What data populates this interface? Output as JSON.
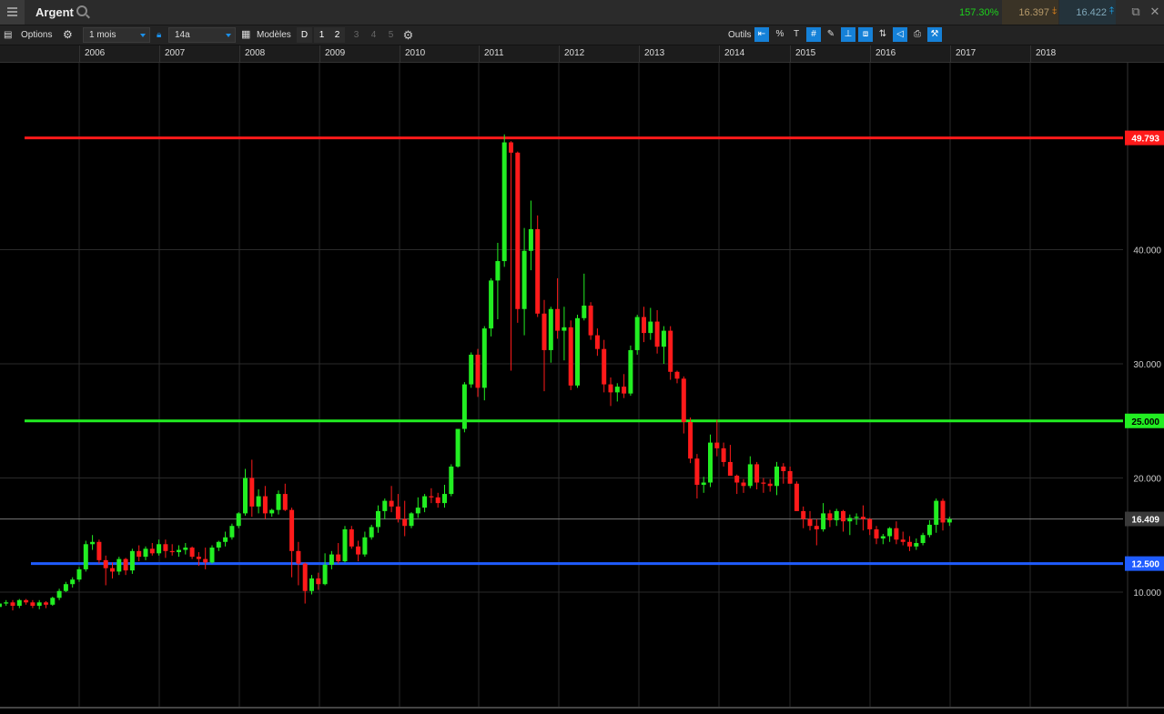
{
  "header": {
    "title": "Argent",
    "change_pct": "157.30%",
    "sell_price": "16.397",
    "buy_price": "16.422"
  },
  "toolbar": {
    "options_label": "Options",
    "interval_value": "1 mois",
    "range_value": "14a",
    "models_label": "Modèles",
    "period_buttons": [
      "D",
      "1",
      "2",
      "3",
      "4",
      "5"
    ],
    "tools_label": "Outils"
  },
  "chart_data": {
    "type": "candlestick",
    "title": "",
    "x_tick_labels": [
      "2006",
      "2007",
      "2008",
      "2009",
      "2010",
      "2011",
      "2012",
      "2013",
      "2014",
      "2015",
      "2016",
      "2017",
      "2018"
    ],
    "y_tick_labels": [
      "10.000",
      "20.000",
      "30.000",
      "40.000"
    ],
    "ylim": [
      2.5,
      52.5
    ],
    "grid": true,
    "current_price": "16.409",
    "horizontal_lines": [
      {
        "value": 49.793,
        "label": "49.793",
        "color": "#ff1a1a"
      },
      {
        "value": 25.0,
        "label": "25.000",
        "color": "#22ee22"
      },
      {
        "value": 12.5,
        "label": "12.500",
        "color": "#1f5cff"
      }
    ],
    "candles": [
      [
        8.7,
        9.3,
        8.3,
        9.0
      ],
      [
        9.0,
        9.3,
        8.8,
        9.1
      ],
      [
        9.1,
        9.3,
        8.4,
        8.8
      ],
      [
        8.8,
        9.4,
        8.6,
        9.3
      ],
      [
        9.3,
        9.4,
        8.9,
        9.1
      ],
      [
        9.1,
        9.3,
        8.6,
        8.8
      ],
      [
        8.8,
        9.3,
        8.5,
        9.1
      ],
      [
        9.1,
        9.2,
        8.6,
        8.9
      ],
      [
        8.9,
        9.6,
        8.8,
        9.5
      ],
      [
        9.5,
        10.3,
        9.3,
        10.1
      ],
      [
        10.1,
        10.9,
        10.0,
        10.7
      ],
      [
        10.7,
        11.3,
        10.4,
        11.1
      ],
      [
        11.1,
        12.2,
        10.9,
        12.0
      ],
      [
        12.0,
        14.5,
        11.8,
        14.2
      ],
      [
        14.2,
        15.0,
        13.7,
        14.4
      ],
      [
        14.4,
        14.6,
        12.5,
        12.8
      ],
      [
        12.8,
        13.2,
        10.6,
        12.1
      ],
      [
        12.1,
        12.6,
        11.2,
        11.8
      ],
      [
        11.8,
        13.1,
        11.5,
        12.9
      ],
      [
        12.9,
        13.0,
        11.5,
        11.9
      ],
      [
        11.9,
        13.8,
        11.6,
        13.6
      ],
      [
        13.6,
        14.1,
        12.7,
        13.1
      ],
      [
        13.1,
        14.0,
        12.8,
        13.8
      ],
      [
        13.8,
        14.3,
        13.2,
        13.4
      ],
      [
        13.4,
        14.6,
        13.2,
        14.2
      ],
      [
        14.2,
        14.6,
        13.0,
        13.6
      ],
      [
        13.6,
        14.2,
        13.2,
        13.5
      ],
      [
        13.5,
        14.1,
        13.1,
        13.7
      ],
      [
        13.7,
        14.3,
        13.3,
        13.9
      ],
      [
        13.9,
        14.0,
        12.9,
        13.1
      ],
      [
        13.1,
        13.5,
        12.3,
        12.9
      ],
      [
        12.9,
        13.9,
        12.0,
        12.6
      ],
      [
        12.6,
        14.1,
        12.5,
        13.9
      ],
      [
        13.9,
        14.5,
        13.6,
        14.4
      ],
      [
        14.4,
        15.3,
        14.0,
        14.8
      ],
      [
        14.8,
        16.0,
        14.6,
        15.8
      ],
      [
        15.8,
        17.0,
        15.6,
        16.9
      ],
      [
        16.9,
        20.8,
        16.7,
        20.0
      ],
      [
        20.0,
        21.6,
        16.6,
        17.5
      ],
      [
        17.5,
        19.0,
        16.9,
        18.4
      ],
      [
        18.4,
        19.3,
        16.4,
        16.9
      ],
      [
        16.9,
        17.3,
        16.6,
        17.2
      ],
      [
        17.2,
        18.9,
        16.8,
        18.6
      ],
      [
        18.6,
        19.5,
        17.1,
        17.2
      ],
      [
        17.2,
        17.4,
        11.3,
        13.6
      ],
      [
        13.6,
        14.4,
        10.6,
        12.5
      ],
      [
        12.5,
        12.6,
        9.0,
        10.1
      ],
      [
        10.1,
        11.5,
        9.8,
        11.2
      ],
      [
        11.2,
        11.7,
        10.2,
        10.7
      ],
      [
        10.7,
        13.4,
        10.6,
        12.4
      ],
      [
        12.4,
        13.6,
        12.0,
        13.3
      ],
      [
        13.3,
        14.3,
        12.5,
        12.7
      ],
      [
        12.7,
        15.8,
        12.6,
        15.5
      ],
      [
        15.5,
        15.8,
        13.8,
        14.0
      ],
      [
        14.0,
        14.5,
        12.7,
        13.3
      ],
      [
        13.3,
        15.3,
        13.1,
        14.8
      ],
      [
        14.8,
        15.9,
        14.6,
        15.7
      ],
      [
        15.7,
        17.6,
        15.2,
        17.1
      ],
      [
        17.1,
        18.2,
        16.4,
        18.0
      ],
      [
        18.0,
        19.3,
        17.0,
        17.5
      ],
      [
        17.5,
        18.6,
        16.1,
        16.4
      ],
      [
        16.4,
        18.0,
        14.9,
        15.8
      ],
      [
        15.8,
        17.0,
        15.6,
        16.9
      ],
      [
        16.9,
        18.3,
        16.5,
        17.4
      ],
      [
        17.4,
        18.6,
        17.0,
        18.4
      ],
      [
        18.4,
        19.1,
        17.8,
        18.3
      ],
      [
        18.3,
        18.7,
        17.4,
        17.8
      ],
      [
        17.8,
        19.4,
        17.4,
        18.6
      ],
      [
        18.6,
        21.2,
        18.4,
        21.0
      ],
      [
        21.0,
        24.1,
        20.9,
        24.3
      ],
      [
        24.3,
        28.4,
        24.0,
        28.2
      ],
      [
        28.2,
        31.0,
        27.9,
        30.8
      ],
      [
        30.8,
        31.3,
        27.1,
        27.9
      ],
      [
        27.9,
        33.3,
        26.8,
        33.1
      ],
      [
        33.1,
        37.5,
        32.4,
        37.3
      ],
      [
        37.3,
        40.6,
        33.9,
        39.0
      ],
      [
        39.0,
        50.1,
        38.5,
        49.4
      ],
      [
        49.4,
        49.5,
        29.4,
        48.5
      ],
      [
        48.5,
        48.6,
        33.6,
        34.8
      ],
      [
        34.8,
        41.9,
        32.5,
        39.9
      ],
      [
        39.9,
        44.3,
        38.2,
        41.8
      ],
      [
        41.8,
        43.0,
        34.1,
        34.4
      ],
      [
        34.4,
        35.6,
        27.6,
        31.2
      ],
      [
        31.2,
        35.0,
        30.1,
        34.8
      ],
      [
        34.8,
        37.5,
        32.2,
        32.9
      ],
      [
        32.9,
        35.0,
        30.3,
        33.2
      ],
      [
        33.2,
        33.8,
        27.7,
        28.1
      ],
      [
        28.1,
        34.3,
        27.9,
        34.0
      ],
      [
        34.0,
        37.9,
        33.8,
        35.1
      ],
      [
        35.1,
        35.4,
        32.1,
        32.5
      ],
      [
        32.5,
        33.1,
        30.7,
        31.3
      ],
      [
        31.3,
        32.1,
        27.5,
        28.2
      ],
      [
        28.2,
        28.8,
        26.3,
        27.5
      ],
      [
        27.5,
        28.3,
        26.7,
        28.0
      ],
      [
        28.0,
        29.1,
        27.0,
        27.4
      ],
      [
        27.4,
        31.6,
        27.2,
        31.2
      ],
      [
        31.2,
        34.3,
        30.8,
        34.1
      ],
      [
        34.1,
        35.0,
        31.9,
        32.7
      ],
      [
        32.7,
        34.9,
        32.1,
        33.7
      ],
      [
        33.7,
        34.7,
        30.9,
        31.5
      ],
      [
        31.5,
        33.3,
        30.0,
        32.9
      ],
      [
        32.9,
        33.3,
        28.6,
        29.3
      ],
      [
        29.3,
        29.4,
        28.3,
        28.7
      ],
      [
        28.7,
        28.9,
        23.9,
        24.9
      ],
      [
        24.9,
        25.3,
        21.3,
        21.7
      ],
      [
        21.7,
        22.1,
        18.2,
        19.4
      ],
      [
        19.4,
        20.1,
        18.7,
        19.6
      ],
      [
        19.6,
        23.8,
        19.2,
        23.1
      ],
      [
        23.1,
        25.1,
        21.9,
        22.6
      ],
      [
        22.6,
        23.1,
        21.0,
        21.4
      ],
      [
        21.4,
        22.9,
        20.6,
        20.2
      ],
      [
        20.2,
        20.3,
        18.6,
        19.6
      ],
      [
        19.6,
        19.9,
        18.7,
        19.3
      ],
      [
        19.3,
        21.9,
        19.1,
        21.2
      ],
      [
        21.2,
        21.4,
        19.0,
        19.6
      ],
      [
        19.6,
        20.0,
        18.7,
        19.5
      ],
      [
        19.5,
        19.9,
        18.8,
        19.3
      ],
      [
        19.3,
        21.4,
        18.5,
        21.0
      ],
      [
        21.0,
        21.3,
        19.5,
        20.6
      ],
      [
        20.6,
        21.0,
        19.5,
        19.5
      ],
      [
        19.5,
        19.7,
        17.1,
        17.1
      ],
      [
        17.1,
        17.5,
        15.6,
        16.4
      ],
      [
        16.4,
        17.1,
        15.4,
        15.8
      ],
      [
        15.8,
        16.4,
        14.1,
        15.5
      ],
      [
        15.5,
        17.8,
        15.3,
        16.9
      ],
      [
        16.9,
        17.2,
        15.7,
        16.3
      ],
      [
        16.3,
        17.3,
        15.8,
        17.1
      ],
      [
        17.1,
        17.2,
        15.3,
        16.2
      ],
      [
        16.2,
        16.8,
        15.0,
        16.5
      ],
      [
        16.5,
        16.9,
        15.9,
        16.6
      ],
      [
        16.6,
        17.6,
        15.4,
        16.4
      ],
      [
        16.4,
        16.5,
        15.0,
        15.5
      ],
      [
        15.5,
        15.8,
        14.2,
        14.7
      ],
      [
        14.7,
        15.1,
        14.2,
        14.9
      ],
      [
        14.9,
        15.7,
        14.4,
        15.6
      ],
      [
        15.6,
        16.2,
        14.2,
        14.6
      ],
      [
        14.6,
        15.3,
        14.1,
        14.4
      ],
      [
        14.4,
        14.9,
        13.6,
        14.0
      ],
      [
        14.0,
        14.7,
        13.7,
        14.3
      ],
      [
        14.3,
        15.2,
        14.1,
        15.0
      ],
      [
        15.0,
        16.3,
        14.8,
        15.9
      ],
      [
        15.9,
        18.2,
        15.2,
        18.0
      ],
      [
        18.0,
        18.2,
        15.4,
        16.1
      ],
      [
        16.1,
        16.6,
        15.8,
        16.4
      ]
    ]
  }
}
